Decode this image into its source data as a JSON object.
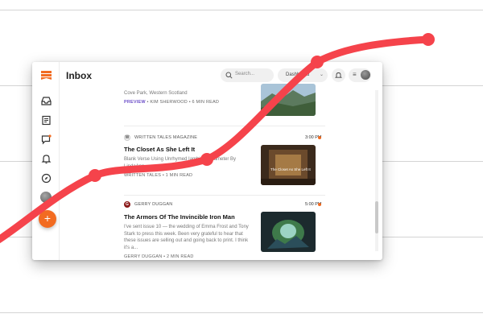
{
  "app": {
    "title": "Inbox",
    "search_placeholder": "Search...",
    "view_selector": "Dashboard",
    "accent": "#f26b21",
    "tag_color": "#6f52c9"
  },
  "sidebar": {
    "items": [
      {
        "icon": "inbox-icon"
      },
      {
        "icon": "article-icon"
      },
      {
        "icon": "chat-icon"
      },
      {
        "icon": "bell-icon"
      },
      {
        "icon": "compass-icon"
      }
    ],
    "fab_label": "+"
  },
  "feed": [
    {
      "excerpt": "Cove Park, Western Scotland",
      "meta_tag": "PREVIEW",
      "meta_rest": "• KIM SHERWOOD • 6 MIN READ",
      "thumb": "landscape"
    },
    {
      "source": "WRITTEN TALES MAGAZINE",
      "source_badge": "W",
      "time": "3:00 PM",
      "headline": "The Closet As She Left It",
      "excerpt": "Blank Verse Using Unrhymed Iambic Pentameter By LindaAnn",
      "meta": "WRITTEN TALES • 1 MIN READ",
      "thumb_caption": "The Closet As She Left It"
    },
    {
      "source": "GERRY DUGGAN",
      "source_badge": "G",
      "time": "5:00 PM",
      "headline": "The Armors Of The Invincible Iron Man",
      "excerpt": "I've sent issue 10 — the wedding of Emma Frost and Tony Stark to press this week. Been very grateful to hear that these issues are selling out and going back to print. I think it's a...",
      "meta": "GERRY DUGGAN • 2 MIN READ"
    }
  ],
  "overlay_line": {
    "color": "#f5434b"
  }
}
